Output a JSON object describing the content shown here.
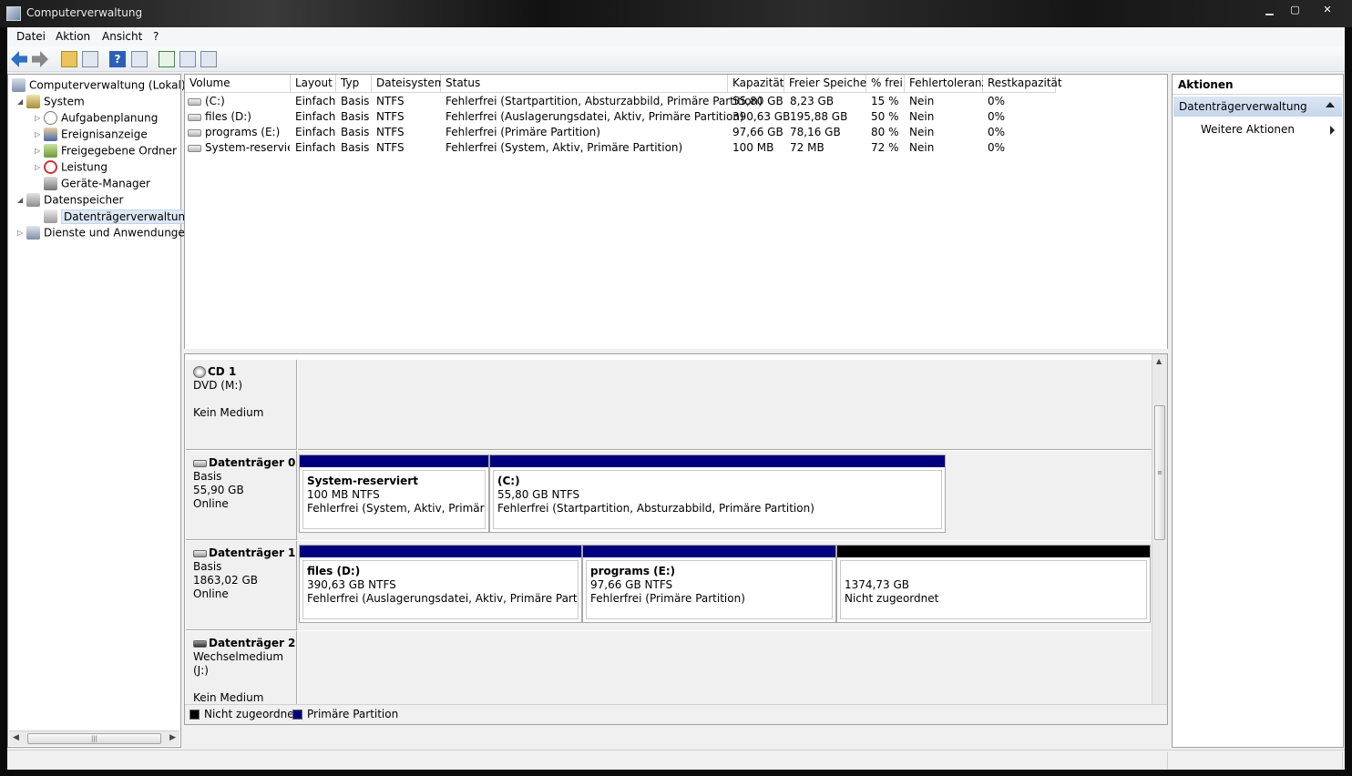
{
  "window": {
    "title": "Computerverwaltung",
    "controls": [
      "minimize-icon",
      "maximize-icon",
      "close-icon"
    ]
  },
  "menu": {
    "items": [
      "Datei",
      "Aktion",
      "Ansicht",
      "?"
    ]
  },
  "toolbar": {
    "icons": [
      "back-arrow-icon",
      "forward-arrow-icon",
      "up-folder-icon",
      "show-hide-tree-icon",
      "help-icon",
      "show-hide-action-icon",
      "refresh-icon",
      "properties-icon",
      "export-list-icon"
    ]
  },
  "tree": {
    "root": "Computerverwaltung (Lokal)",
    "system": "System",
    "aufgabenplanung": "Aufgabenplanung",
    "ereignisanzeige": "Ereignisanzeige",
    "freigegebene": "Freigegebene Ordner",
    "leistung": "Leistung",
    "geraete": "Geräte-Manager",
    "datenspeicher": "Datenspeicher",
    "datentraeger": "Datenträgerverwaltung",
    "dienste": "Dienste und Anwendungen"
  },
  "volumes": {
    "headers": [
      "Volume",
      "Layout",
      "Typ",
      "Dateisystem",
      "Status",
      "Kapazität",
      "Freier Speicher",
      "% frei",
      "Fehlertoleranz",
      "Restkapazität"
    ],
    "rows": [
      [
        "(C:)",
        "Einfach",
        "Basis",
        "NTFS",
        "Fehlerfrei (Startpartition, Absturzabbild, Primäre Partition)",
        "55,80 GB",
        "8,23 GB",
        "15 %",
        "Nein",
        "0%"
      ],
      [
        "files (D:)",
        "Einfach",
        "Basis",
        "NTFS",
        "Fehlerfrei (Auslagerungsdatei, Aktiv, Primäre Partition)",
        "390,63 GB",
        "195,88 GB",
        "50 %",
        "Nein",
        "0%"
      ],
      [
        "programs (E:)",
        "Einfach",
        "Basis",
        "NTFS",
        "Fehlerfrei (Primäre Partition)",
        "97,66 GB",
        "78,16 GB",
        "80 %",
        "Nein",
        "0%"
      ],
      [
        "System-reserviert",
        "Einfach",
        "Basis",
        "NTFS",
        "Fehlerfrei (System, Aktiv, Primäre Partition)",
        "100 MB",
        "72 MB",
        "72 %",
        "Nein",
        "0%"
      ]
    ]
  },
  "disks": {
    "cd1": {
      "name": "CD 1",
      "line1": "DVD (M:)",
      "line2": "Kein Medium"
    },
    "disk0": {
      "name": "Datenträger 0",
      "type": "Basis",
      "size": "55,90 GB",
      "state": "Online",
      "p1": {
        "name": "System-reserviert",
        "size": "100 MB NTFS",
        "status": "Fehlerfrei (System, Aktiv, Primäre Par"
      },
      "p2": {
        "name": "(C:)",
        "size": "55,80 GB NTFS",
        "status": "Fehlerfrei (Startpartition, Absturzabbild, Primäre Partition)"
      }
    },
    "disk1": {
      "name": "Datenträger 1",
      "type": "Basis",
      "size": "1863,02 GB",
      "state": "Online",
      "p1": {
        "name": "files  (D:)",
        "size": "390,63 GB NTFS",
        "status": "Fehlerfrei (Auslagerungsdatei, Aktiv, Primäre Partition)"
      },
      "p2": {
        "name": "programs  (E:)",
        "size": "97,66 GB NTFS",
        "status": "Fehlerfrei (Primäre Partition)"
      },
      "p3": {
        "size": "1374,73 GB",
        "status": "Nicht zugeordnet"
      }
    },
    "disk2": {
      "name": "Datenträger 2",
      "line1": "Wechselmedium (J:)",
      "line2": "Kein Medium"
    }
  },
  "legend": {
    "unallocated": "Nicht zugeordnet",
    "primary": "Primäre Partition",
    "unallocated_color": "#000000",
    "primary_color": "#00007f"
  },
  "actions": {
    "header": "Aktionen",
    "section": "Datenträgerverwaltung",
    "more": "Weitere Aktionen"
  }
}
